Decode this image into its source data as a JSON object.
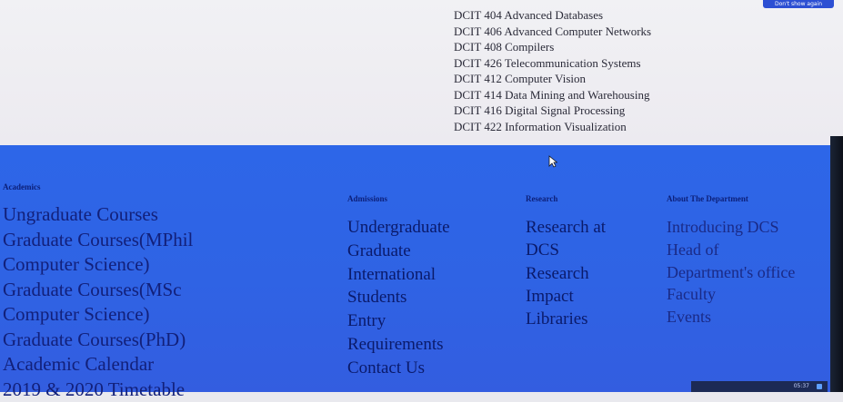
{
  "banner": {
    "dont_show_label": "Don't show again"
  },
  "courses": [
    "DCIT 404 Advanced Databases",
    "DCIT 406 Advanced Computer Networks",
    "DCIT 408 Compilers",
    "DCIT 426 Telecommunication Systems",
    "DCIT 412 Computer Vision",
    "DCIT 414 Data Mining and Warehousing",
    "DCIT 416 Digital Signal Processing",
    "DCIT 422 Information Visualization"
  ],
  "footer": {
    "academics": {
      "heading": "Academics",
      "links": [
        "Ungraduate Courses",
        "Graduate Courses(MPhil",
        "Computer Science)",
        "Graduate Courses(MSc",
        "Computer Science)",
        "Graduate Courses(PhD)",
        "Academic Calendar",
        "2019 & 2020 Timetable"
      ]
    },
    "admissions": {
      "heading": "Admissions",
      "links": [
        "Undergraduate",
        "Graduate",
        "International",
        "Students",
        "Entry",
        "Requirements",
        "Contact Us"
      ]
    },
    "research": {
      "heading": "Research",
      "links": [
        "Research at",
        "DCS",
        "Research",
        "Impact",
        "Libraries"
      ]
    },
    "about": {
      "heading": "About The Department",
      "links": [
        "Introducing DCS",
        "Head of",
        "Department's office",
        "Faculty",
        "Events"
      ]
    }
  },
  "taskbar": {
    "time": "05:37"
  }
}
